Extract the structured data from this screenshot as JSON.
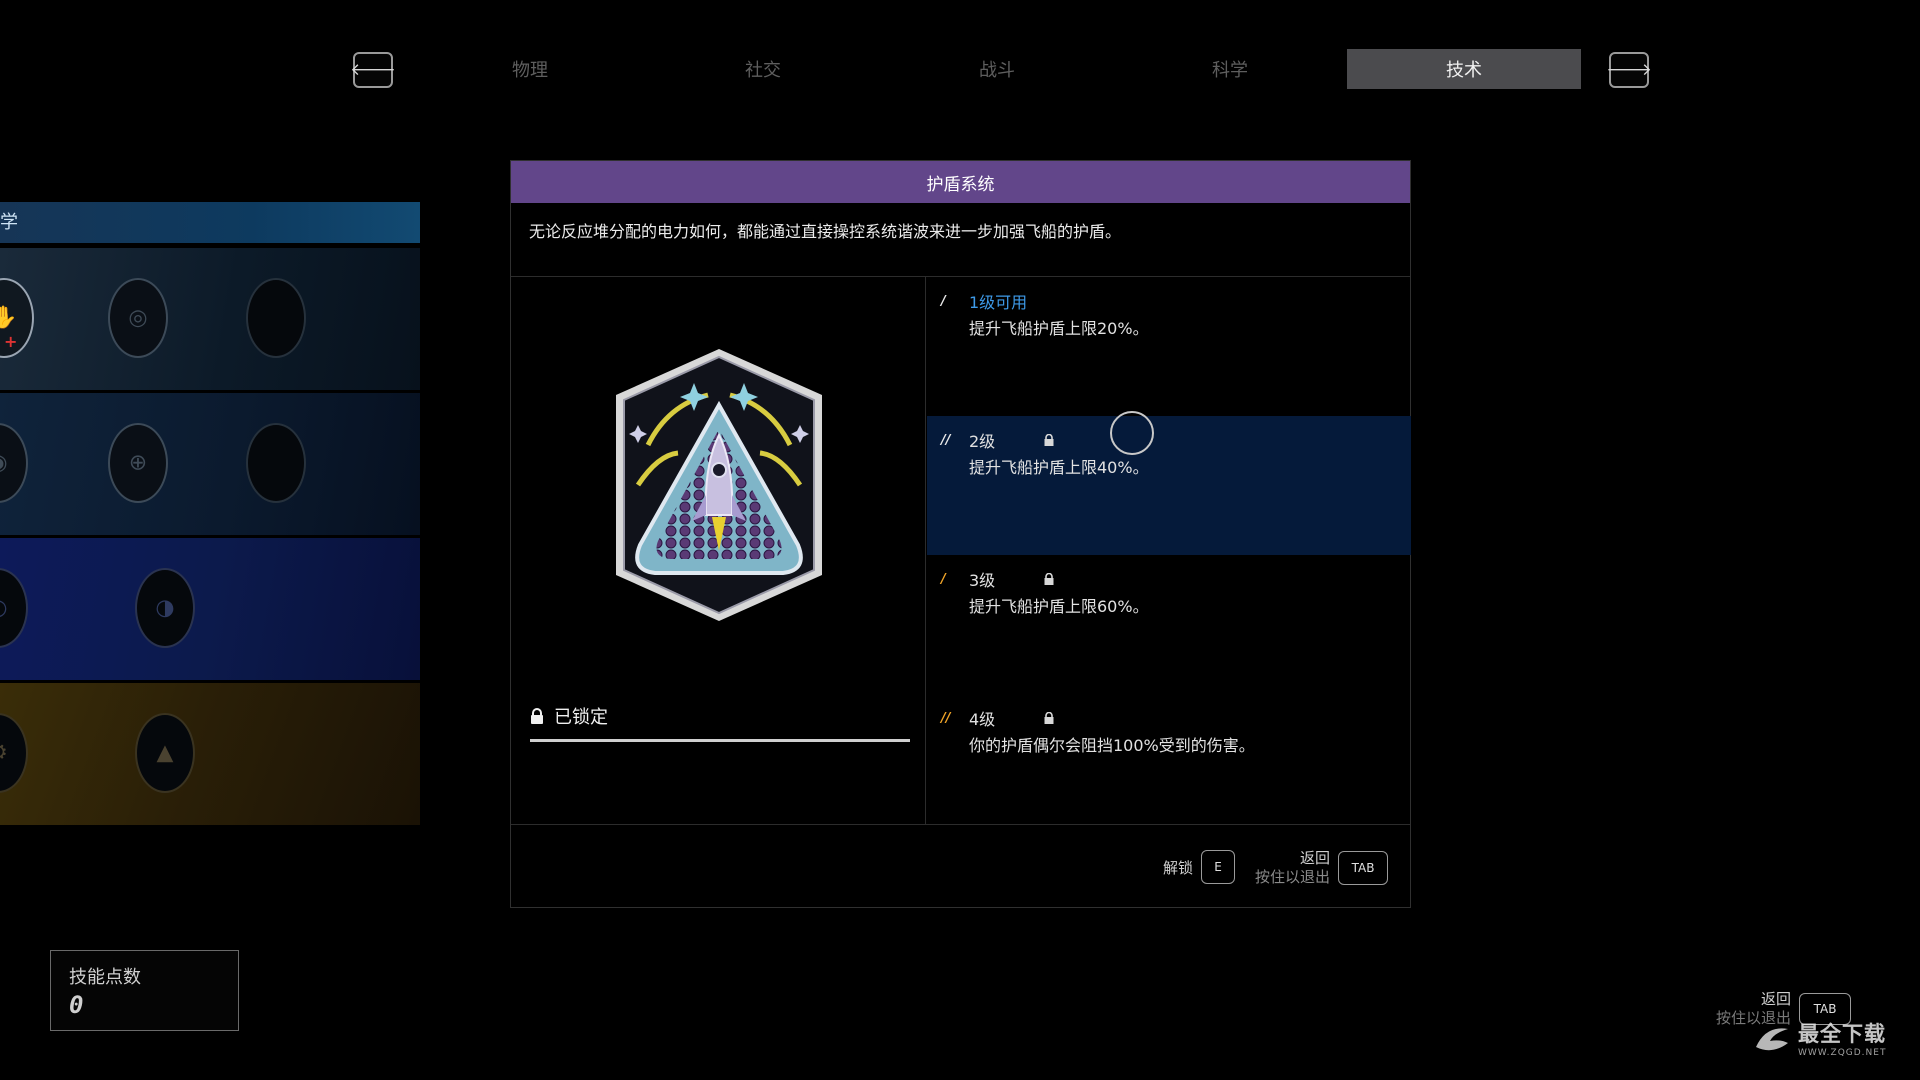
{
  "tabs": {
    "prev_icon": "arrow-left-icon",
    "next_icon": "arrow-right-icon",
    "prev_glyph": "🡐",
    "next_glyph": "🡒",
    "items": [
      {
        "label": "物理"
      },
      {
        "label": "社交"
      },
      {
        "label": "战斗"
      },
      {
        "label": "科学"
      },
      {
        "label": "技术",
        "active": true
      }
    ]
  },
  "tree": {
    "header": "学"
  },
  "skill_points": {
    "label": "技能点数",
    "value": "0"
  },
  "panel": {
    "title": "护盾系统",
    "description": "无论反应堆分配的电力如何，都能通过直接操控系统谐波来进一步加强飞船的护盾。",
    "lock_status": "已锁定",
    "ranks": [
      {
        "pip": "/",
        "name": "1级可用",
        "desc": "提升飞船护盾上限20%。",
        "available": true
      },
      {
        "pip": "//",
        "name": "2级",
        "desc": "提升飞船护盾上限40%。",
        "locked": true
      },
      {
        "pip": "/",
        "name": "3级",
        "desc": "提升飞船护盾上限60%。",
        "locked": true
      },
      {
        "pip": "//",
        "name": "4级",
        "desc": "你的护盾偶尔会阻挡100%受到的伤害。",
        "locked": true
      }
    ],
    "footer": {
      "unlock_label": "解锁",
      "unlock_key": "E",
      "back_label": "返回",
      "back_sub": "按住以退出",
      "back_key": "TAB"
    }
  },
  "bottom_hint": {
    "label": "返回",
    "sub": "按住以退出",
    "key": "TAB"
  },
  "watermark": {
    "title": "最全下载",
    "url": "WWW.ZQGD.NET"
  },
  "colors": {
    "title_bar": "#62468a",
    "selected_rank": "#051a3a",
    "available": "#3e9ae8",
    "pip_orange": "#f0a428",
    "active_tab": "#4b4b4e"
  }
}
